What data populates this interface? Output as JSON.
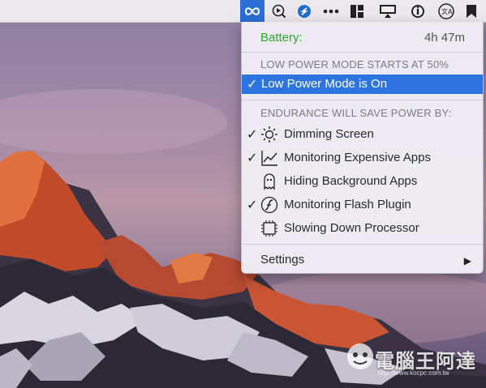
{
  "colors": {
    "accent": "#2d74e0",
    "battery_label": "#2ca82c",
    "section_heading": "#7d7a82"
  },
  "menubar": {
    "icons": [
      {
        "name": "endurance-infinity-icon",
        "active": true
      },
      {
        "name": "play-search-icon"
      },
      {
        "name": "shortcut-s-icon"
      },
      {
        "name": "more-dots-icon"
      },
      {
        "name": "layout-grid-icon"
      },
      {
        "name": "display-sync-icon"
      },
      {
        "name": "info-i-icon"
      },
      {
        "name": "translate-icon"
      },
      {
        "name": "bookmark-icon"
      }
    ]
  },
  "menu": {
    "battery_label": "Battery:",
    "battery_time": "4h 47m",
    "low_power_heading": "LOW POWER MODE STARTS AT 50%",
    "low_power_item": "Low Power Mode is On",
    "check_mark": "✓",
    "endurance_heading": "ENDURANCE WILL SAVE POWER BY:",
    "items": [
      {
        "label": "Dimming Screen",
        "checked": true,
        "icon": "sun-icon"
      },
      {
        "label": "Monitoring Expensive Apps",
        "checked": true,
        "icon": "chart-line-icon"
      },
      {
        "label": "Hiding Background Apps",
        "checked": false,
        "icon": "ghost-icon"
      },
      {
        "label": "Monitoring Flash Plugin",
        "checked": true,
        "icon": "flash-plugin-icon"
      },
      {
        "label": "Slowing Down Processor",
        "checked": false,
        "icon": "cpu-chip-icon"
      }
    ],
    "settings_label": "Settings",
    "submenu_arrow": "▶"
  },
  "watermark": {
    "text": "電腦王阿達",
    "sub": "http://www.kocpc.com.tw"
  }
}
